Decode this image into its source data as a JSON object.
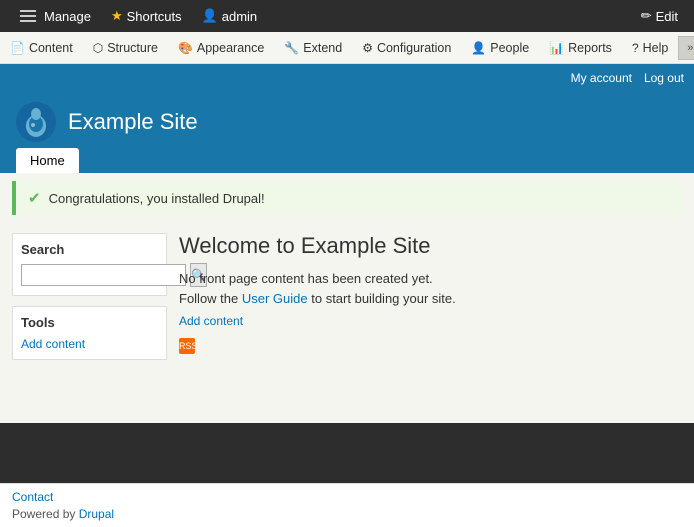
{
  "adminToolbar": {
    "manage_label": "Manage",
    "shortcuts_label": "Shortcuts",
    "admin_label": "admin",
    "edit_label": "Edit"
  },
  "menuBar": {
    "items": [
      {
        "id": "content",
        "label": "Content",
        "icon": "📄"
      },
      {
        "id": "structure",
        "label": "Structure",
        "icon": "⬡"
      },
      {
        "id": "appearance",
        "label": "Appearance",
        "icon": "🎨"
      },
      {
        "id": "extend",
        "label": "Extend",
        "icon": "🔧"
      },
      {
        "id": "configuration",
        "label": "Configuration",
        "icon": "⚙"
      },
      {
        "id": "people",
        "label": "People",
        "icon": "👤"
      },
      {
        "id": "reports",
        "label": "Reports",
        "icon": "📊"
      },
      {
        "id": "help",
        "label": "Help",
        "icon": "?"
      }
    ]
  },
  "userBar": {
    "my_account": "My account",
    "log_out": "Log out"
  },
  "siteHeader": {
    "site_name": "Example Site"
  },
  "navigation": {
    "home_tab": "Home"
  },
  "message": {
    "success_text": "Congratulations, you installed Drupal!"
  },
  "sidebar": {
    "search_label": "Search",
    "search_placeholder": "",
    "search_btn_label": "🔍",
    "tools_label": "Tools",
    "add_content_label": "Add content"
  },
  "pageContent": {
    "title": "Welcome to Example Site",
    "body_text": "No front page content has been created yet.",
    "body_text2": "Follow the ",
    "user_guide_link": "User Guide",
    "body_text3": " to start building your site.",
    "add_content_link": "Add content"
  },
  "footer": {
    "contact_label": "Contact",
    "powered_text": "Powered by ",
    "drupal_link": "Drupal"
  },
  "colors": {
    "accent_blue": "#1976a8",
    "dark_bg": "#2d2d2d",
    "success_green": "#5cb85c"
  }
}
